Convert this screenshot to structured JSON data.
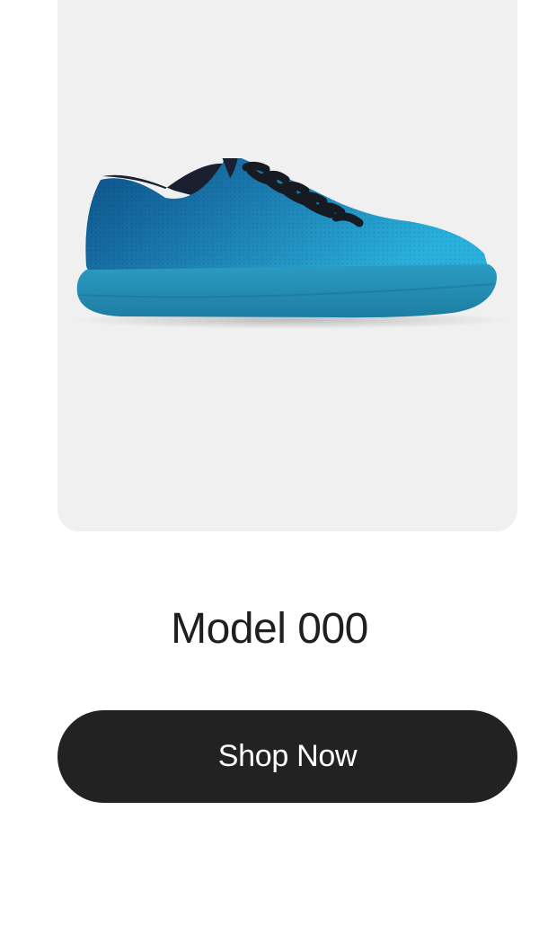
{
  "product": {
    "name": "Model 000",
    "image": {
      "icon": "sneaker-image",
      "colors": {
        "upper_dark": "#0b4f86",
        "upper_light": "#28a5d4",
        "sole": "#2893b9",
        "laces": "#1a1d24",
        "card_bg": "#f0f0f0"
      }
    }
  },
  "cta": {
    "label": "Shop Now",
    "background": "#222222",
    "text_color": "#ffffff"
  }
}
